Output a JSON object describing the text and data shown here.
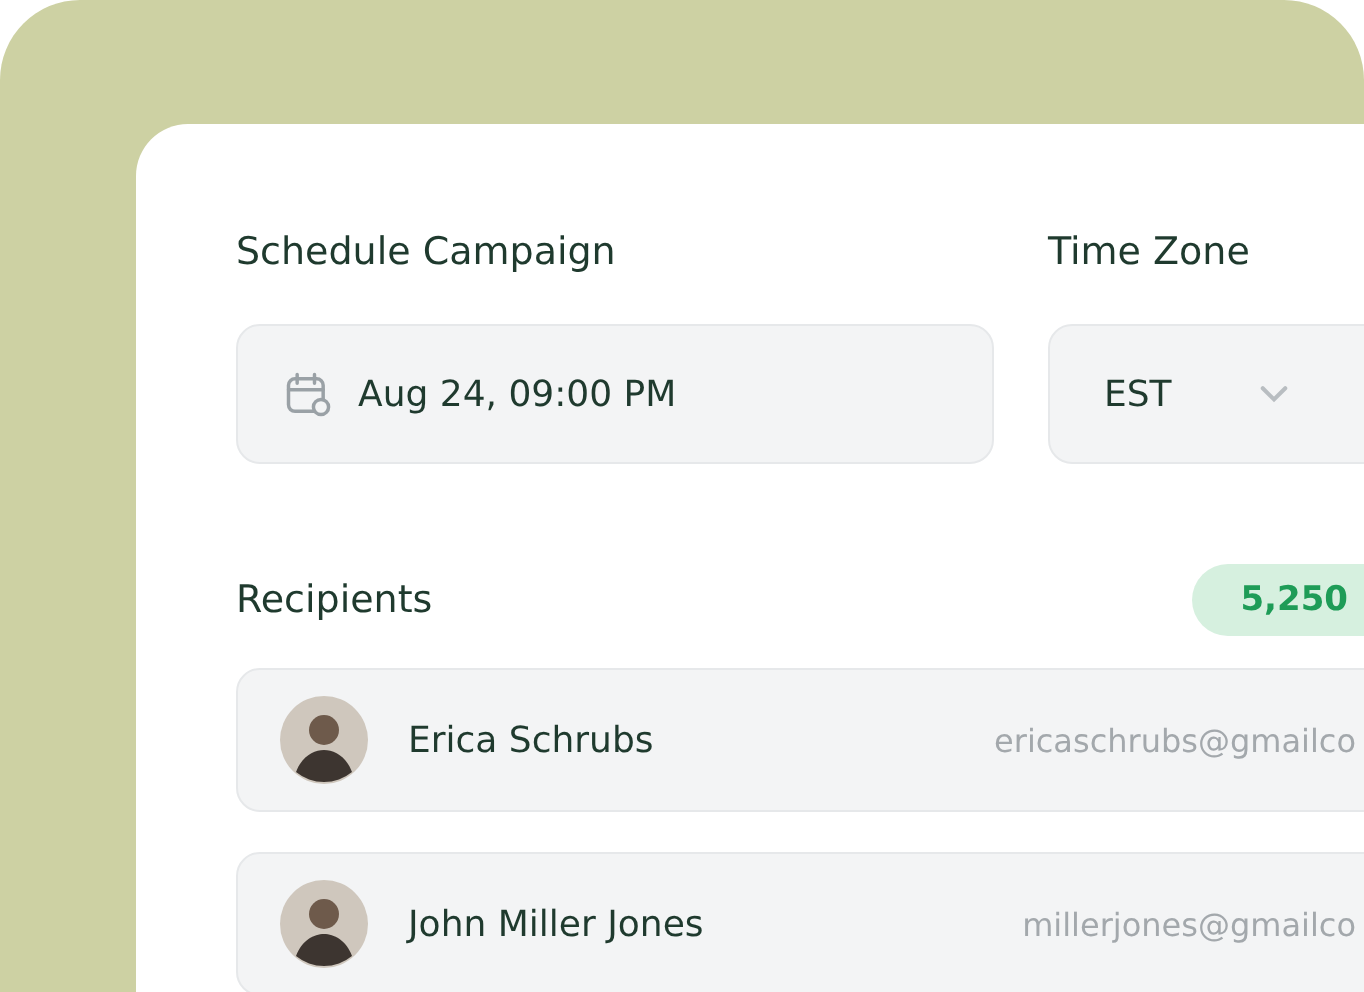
{
  "schedule": {
    "label": "Schedule Campaign",
    "value": "Aug 24, 09:00 PM"
  },
  "time_zone": {
    "label": "Time Zone",
    "value": "EST"
  },
  "recipients": {
    "label": "Recipients",
    "count": "5,250",
    "items": [
      {
        "name": "Erica Schrubs",
        "email": "ericaschrubs@gmailco"
      },
      {
        "name": "John Miller Jones",
        "email": "millerjones@gmailco"
      }
    ]
  }
}
